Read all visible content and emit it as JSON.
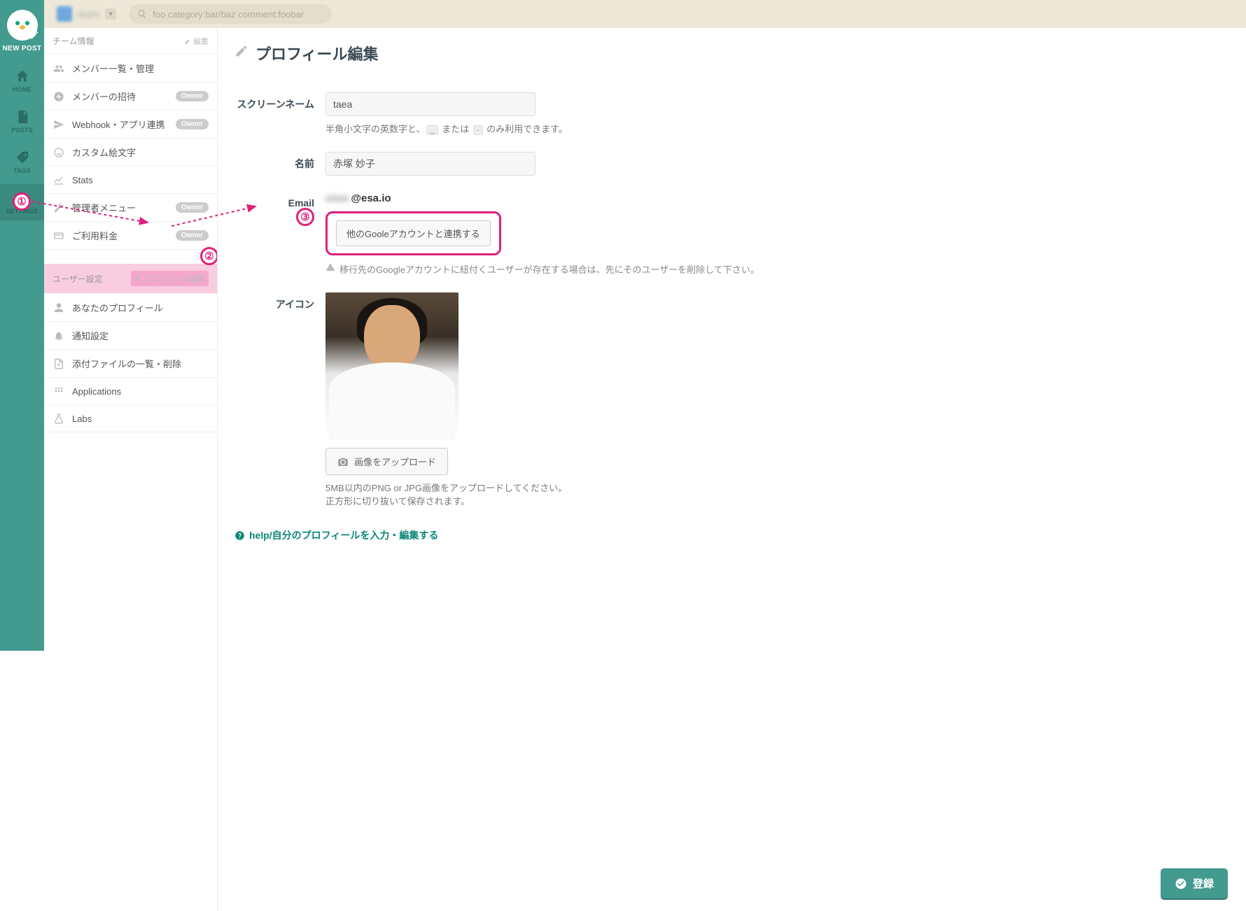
{
  "rail": {
    "new_post": "NEW POST",
    "items": [
      {
        "label": "HOME"
      },
      {
        "label": "POSTS"
      },
      {
        "label": "TAGS"
      },
      {
        "label": "SETTINGS"
      }
    ]
  },
  "topbar": {
    "team_name": "team",
    "search_placeholder": "foo category:bar/baz comment:foobar"
  },
  "sidebar": {
    "team_section": {
      "header": "チーム情報",
      "edit": "編集",
      "items": [
        {
          "label": "メンバー一覧・管理",
          "badge": null
        },
        {
          "label": "メンバーの招待",
          "badge": "Owner"
        },
        {
          "label": "Webhook・アプリ連携",
          "badge": "Owner"
        },
        {
          "label": "カスタム絵文字",
          "badge": null
        },
        {
          "label": "Stats",
          "badge": null
        },
        {
          "label": "管理者メニュー",
          "badge": "Owner"
        },
        {
          "label": "ご利用料金",
          "badge": "Owner"
        }
      ]
    },
    "user_section": {
      "header": "ユーザー設定",
      "edit": "プロフィール編集",
      "items": [
        {
          "label": "あなたのプロフィール"
        },
        {
          "label": "通知設定"
        },
        {
          "label": "添付ファイルの一覧・削除"
        },
        {
          "label": "Applications"
        },
        {
          "label": "Labs"
        }
      ]
    }
  },
  "page": {
    "title": "プロフィール編集",
    "screen_name": {
      "label": "スクリーンネーム",
      "value": "taea",
      "hint_pre": "半角小文字の英数字と、",
      "hint_k1": "_",
      "hint_mid": "または",
      "hint_k2": "-",
      "hint_post": "のみ利用できます。"
    },
    "name": {
      "label": "名前",
      "value": "赤塚 妙子"
    },
    "email": {
      "label": "Email",
      "domain": "@esa.io",
      "link_btn": "他のGooleアカウントと連携する",
      "warn": "移行先のGoogleアカウントに紐付くユーザーが存在する場合は、先にそのユーザーを削除して下さい。"
    },
    "icon": {
      "label": "アイコン",
      "upload_btn": "画像をアップロード",
      "hint1": "5MB以内のPNG or JPG画像をアップロードしてください。",
      "hint2": "正方形に切り抜いて保存されます。"
    },
    "help": "help/自分のプロフィールを入力・編集する",
    "submit": "登録"
  },
  "markers": {
    "m1": "①",
    "m2": "②",
    "m3": "③"
  },
  "colors": {
    "accent": "#e01f7c",
    "teal": "#439a8e"
  }
}
